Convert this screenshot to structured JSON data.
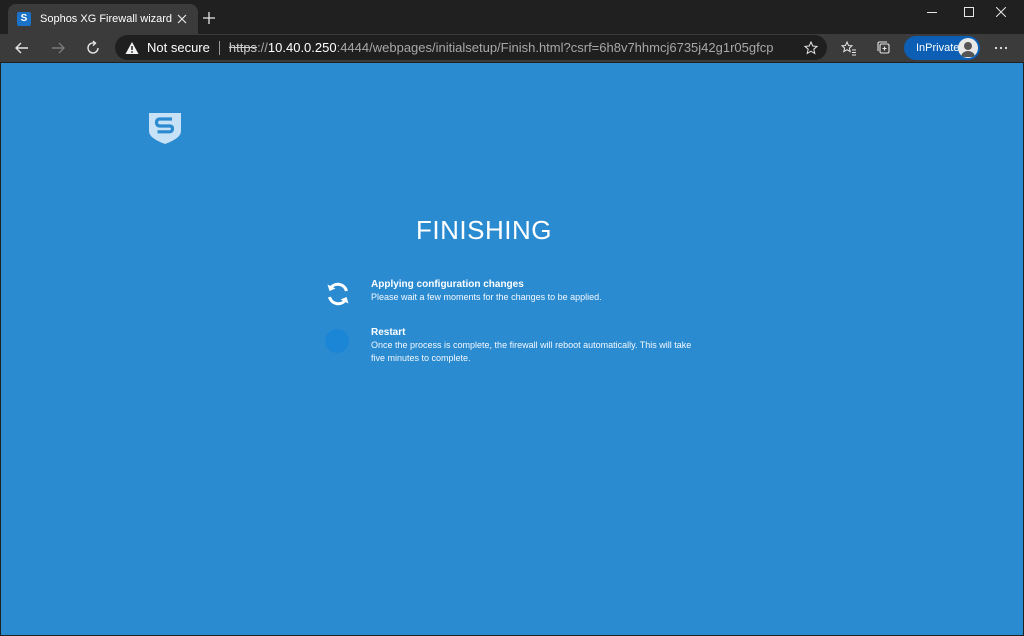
{
  "browser": {
    "tab": {
      "favicon_letter": "S",
      "title": "Sophos XG Firewall wizard"
    },
    "address_bar": {
      "security_label": "Not secure",
      "url_scheme": "https",
      "url_separator": "://",
      "url_host": "10.40.0.250",
      "url_rest": ":4444/webpages/initialsetup/Finish.html?csrf=6h8v7hhmcj6735j42g1r05gfcp"
    },
    "profile": {
      "label": "InPrivate"
    }
  },
  "page": {
    "heading": "FINISHING",
    "steps": [
      {
        "title": "Applying configuration changes",
        "description": "Please wait a few moments for the changes to be applied."
      },
      {
        "title": "Restart",
        "description": "Once the process is complete, the firewall will reboot automatically. This will take five minutes to complete."
      }
    ]
  },
  "colors": {
    "page_background": "#2b8bd1",
    "browser_chrome": "#3b3b3b",
    "inprivate_badge": "#0c5fb4",
    "pending_step": "#1b86d6"
  },
  "icons": {
    "tab": "sophos-favicon",
    "toolbar": [
      "back-icon",
      "forward-icon",
      "refresh-icon",
      "warning-icon",
      "star-icon",
      "favorites-icon",
      "collections-icon",
      "more-icon"
    ],
    "page": [
      "sophos-shield-logo",
      "sync-icon"
    ]
  }
}
